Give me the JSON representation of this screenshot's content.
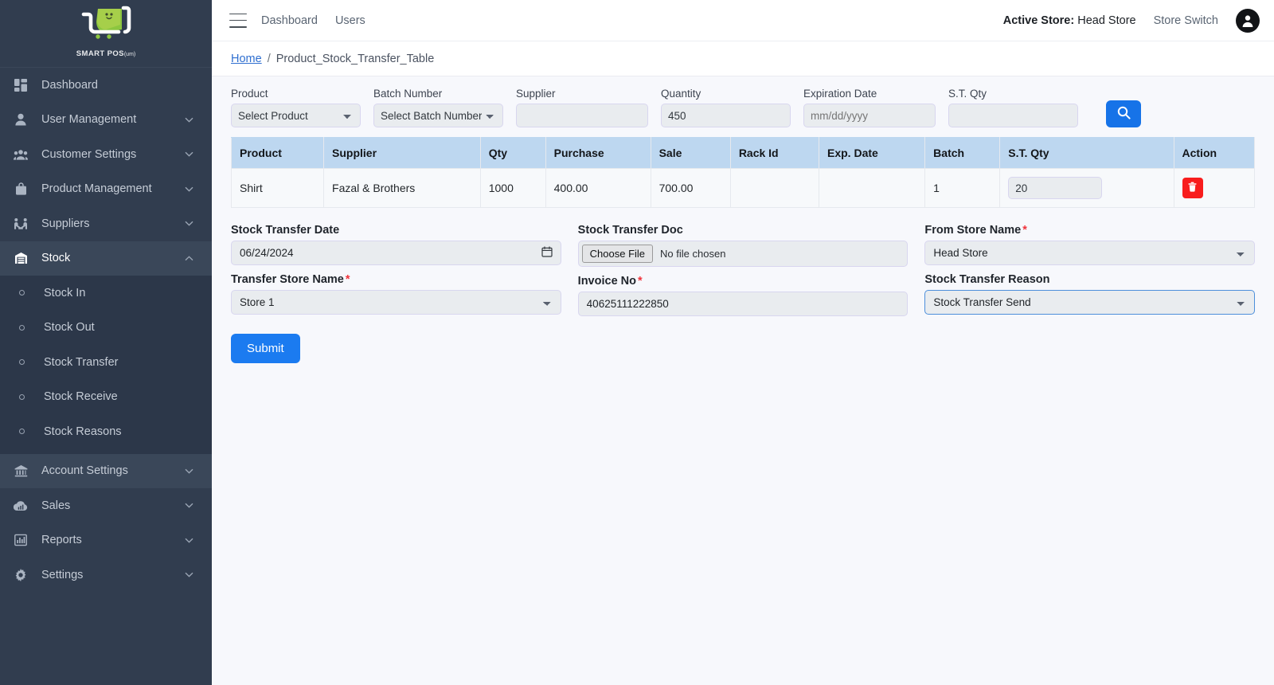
{
  "brand": {
    "name": "SMART POS",
    "suffix": "(um)"
  },
  "topbar": {
    "links": [
      {
        "label": "Dashboard"
      },
      {
        "label": "Users"
      }
    ],
    "active_store_label": "Active Store:",
    "active_store_value": "Head Store",
    "store_switch": "Store Switch"
  },
  "breadcrumb": {
    "home": "Home",
    "separator": "/",
    "current": "Product_Stock_Transfer_Table"
  },
  "sidebar": {
    "items": [
      {
        "label": "Dashboard",
        "icon": "grid-icon",
        "caret": false
      },
      {
        "label": "User Management",
        "icon": "user-icon",
        "caret": true
      },
      {
        "label": "Customer Settings",
        "icon": "users-icon",
        "caret": true
      },
      {
        "label": "Product Management",
        "icon": "bag-icon",
        "caret": true
      },
      {
        "label": "Suppliers",
        "icon": "handshake-icon",
        "caret": true
      },
      {
        "label": "Stock",
        "icon": "warehouse-icon",
        "caret": true,
        "expanded": true
      }
    ],
    "stock_submenu": [
      {
        "label": "Stock In"
      },
      {
        "label": "Stock Out"
      },
      {
        "label": "Stock Transfer"
      },
      {
        "label": "Stock Receive"
      },
      {
        "label": "Stock Reasons"
      }
    ],
    "items_after": [
      {
        "label": "Account Settings",
        "icon": "bank-icon",
        "caret": true
      },
      {
        "label": "Sales",
        "icon": "cloud-chart-icon",
        "caret": true
      },
      {
        "label": "Reports",
        "icon": "bar-chart-icon",
        "caret": true
      },
      {
        "label": "Settings",
        "icon": "gear-icon",
        "caret": true
      }
    ]
  },
  "filters": {
    "product": {
      "label": "Product",
      "value": "Select Product"
    },
    "batch": {
      "label": "Batch Number",
      "value": "Select Batch Number"
    },
    "supplier": {
      "label": "Supplier",
      "value": "",
      "placeholder": ""
    },
    "quantity": {
      "label": "Quantity",
      "value": "450"
    },
    "expiration": {
      "label": "Expiration Date",
      "value": "",
      "placeholder": "mm/dd/yyyy"
    },
    "st_qty": {
      "label": "S.T. Qty",
      "value": "",
      "placeholder": ""
    },
    "search_icon": "search-icon"
  },
  "table": {
    "columns": [
      "Product",
      "Supplier",
      "Qty",
      "Purchase",
      "Sale",
      "Rack Id",
      "Exp. Date",
      "Batch",
      "S.T. Qty",
      "Action"
    ],
    "rows": [
      {
        "product": "Shirt",
        "supplier": "Fazal & Brothers",
        "qty": "1000",
        "purchase": "400.00",
        "sale": "700.00",
        "rack_id": "",
        "exp_date": "",
        "batch": "1",
        "st_qty": "20",
        "action_icon": "trash-icon"
      }
    ]
  },
  "form": {
    "stock_transfer_date": {
      "label": "Stock Transfer Date",
      "value": "06/24/2024"
    },
    "transfer_store_name": {
      "label": "Transfer Store Name",
      "required": true,
      "value": "Store 1"
    },
    "stock_transfer_doc": {
      "label": "Stock Transfer Doc",
      "button": "Choose File",
      "file_status": "No file chosen"
    },
    "invoice_no": {
      "label": "Invoice No",
      "required": true,
      "value": "40625111222850"
    },
    "from_store_name": {
      "label": "From Store Name",
      "required": true,
      "value": "Head Store"
    },
    "stock_transfer_reason": {
      "label": "Stock Transfer Reason",
      "value": "Stock Transfer Send",
      "focused": true
    },
    "submit": "Submit"
  },
  "colors": {
    "sidebar_bg": "#313d4f",
    "submenu_bg": "#2c3749",
    "accent_blue": "#1b7bf0",
    "table_header": "#bdd7f0",
    "danger_red": "#f81d1d",
    "required_red": "#f0343c",
    "link_blue": "#2f6fd0",
    "logo_green": "#8cc63f"
  }
}
